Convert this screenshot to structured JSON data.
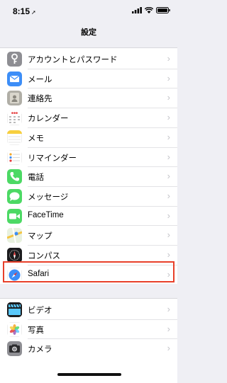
{
  "status": {
    "time": "8:15",
    "location_glyph": "➚"
  },
  "nav": {
    "title": "設定"
  },
  "rows_group1": [
    {
      "name": "passwords",
      "label": "アカウントとパスワード",
      "icon": "key-icon",
      "color": "#8e8e93"
    },
    {
      "name": "mail",
      "label": "メール",
      "icon": "mail-icon",
      "color": "#3d8ef7"
    },
    {
      "name": "contacts",
      "label": "連絡先",
      "icon": "contacts-icon",
      "color": "#b0aea6"
    },
    {
      "name": "calendar",
      "label": "カレンダー",
      "icon": "calendar-icon",
      "color": "#ffffff"
    },
    {
      "name": "notes",
      "label": "メモ",
      "icon": "notes-icon",
      "color": "#ffffff"
    },
    {
      "name": "reminders",
      "label": "リマインダー",
      "icon": "reminders-icon",
      "color": "#ffffff"
    },
    {
      "name": "phone",
      "label": "電話",
      "icon": "phone-icon",
      "color": "#4cd964"
    },
    {
      "name": "messages",
      "label": "メッセージ",
      "icon": "messages-icon",
      "color": "#4cd964"
    },
    {
      "name": "facetime",
      "label": "FaceTime",
      "icon": "facetime-icon",
      "color": "#4cd964"
    },
    {
      "name": "maps",
      "label": "マップ",
      "icon": "maps-icon",
      "color": "#e8f1df"
    },
    {
      "name": "compass",
      "label": "コンパス",
      "icon": "compass-icon",
      "color": "#1c1c1e"
    },
    {
      "name": "safari",
      "label": "Safari",
      "icon": "safari-icon",
      "color": "#ffffff"
    }
  ],
  "rows_group2": [
    {
      "name": "videos",
      "label": "ビデオ",
      "icon": "videos-icon",
      "color": "#1c1c1e"
    },
    {
      "name": "photos",
      "label": "写真",
      "icon": "photos-icon",
      "color": "#ffffff"
    },
    {
      "name": "camera",
      "label": "カメラ",
      "icon": "camera-icon",
      "color": "#8e8e93"
    }
  ],
  "highlighted_row": "Safari",
  "colors": {
    "highlight": "#e8402a",
    "background": "#efeff4"
  }
}
